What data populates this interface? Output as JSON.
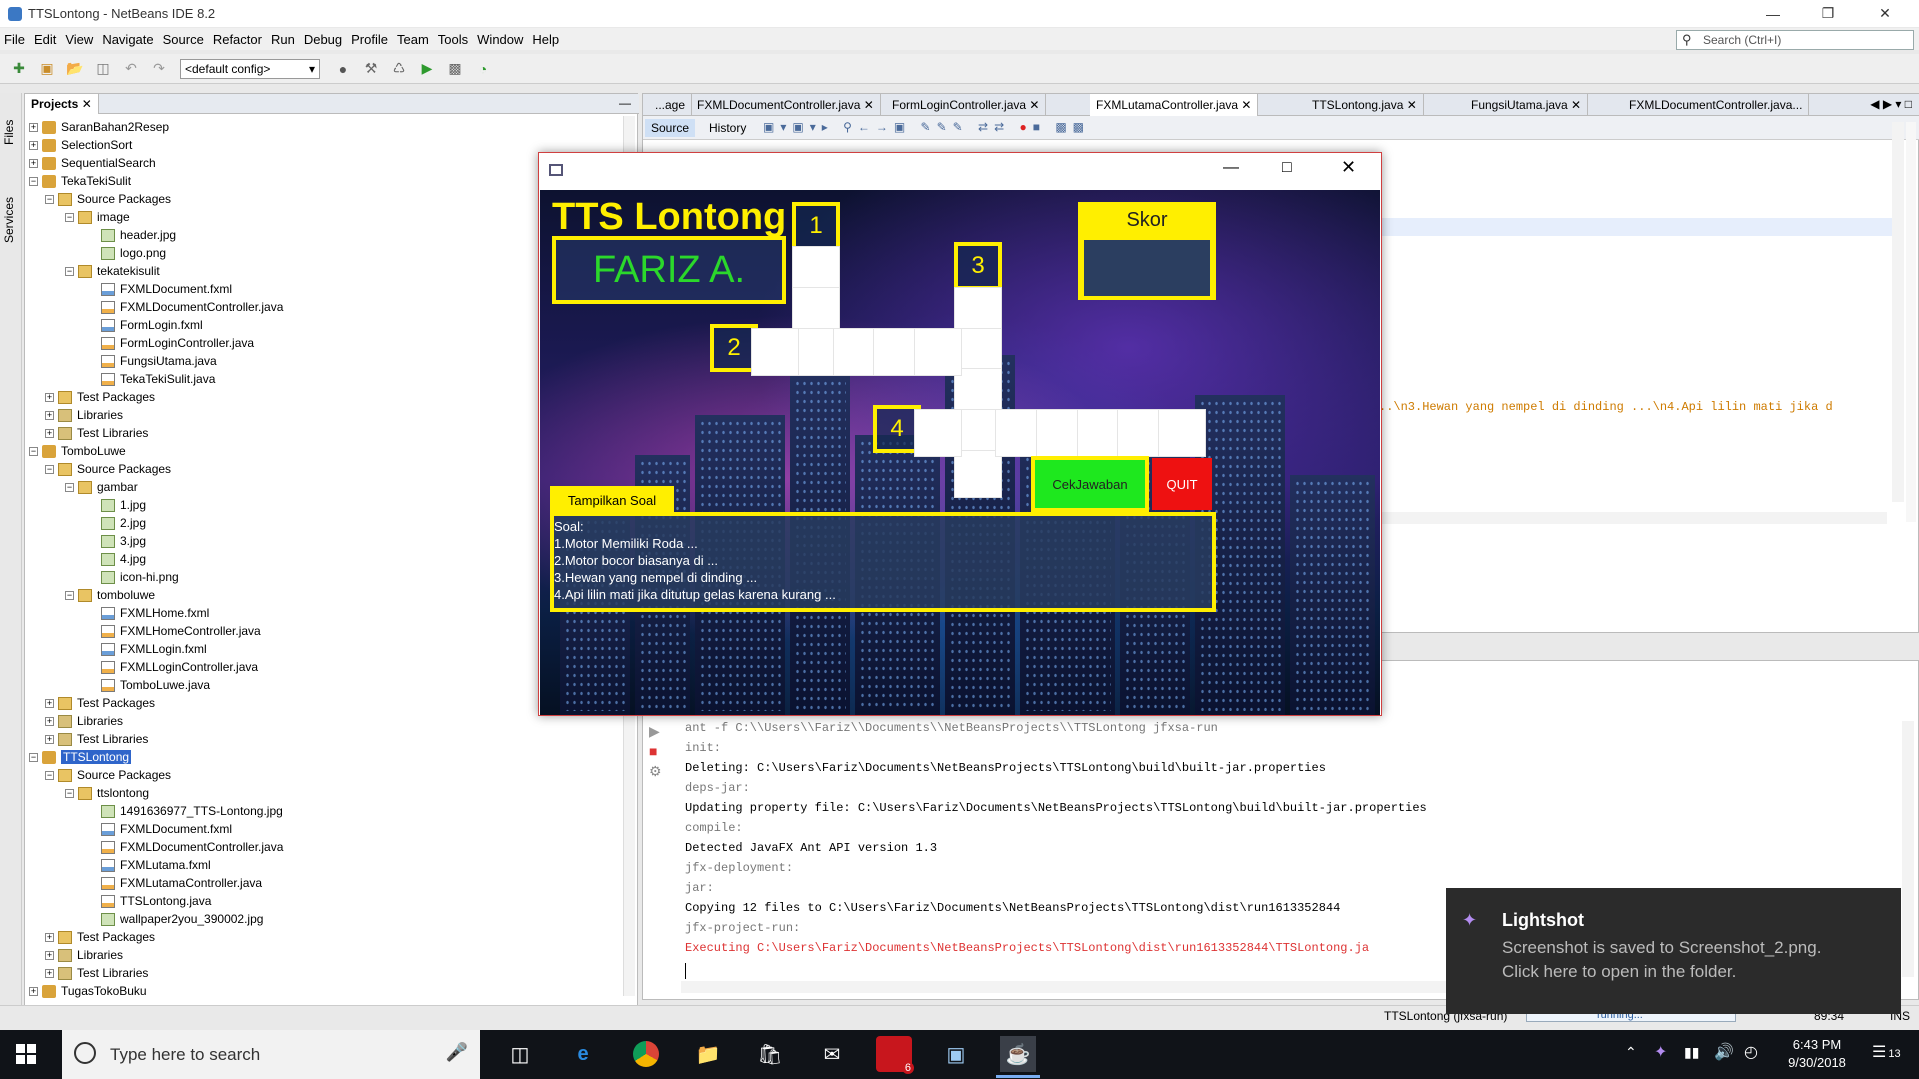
{
  "window": {
    "title": "TTSLontong - NetBeans IDE 8.2"
  },
  "menu": [
    "File",
    "Edit",
    "View",
    "Navigate",
    "Source",
    "Refactor",
    "Run",
    "Debug",
    "Profile",
    "Team",
    "Tools",
    "Window",
    "Help"
  ],
  "search": {
    "placeholder": "Search (Ctrl+I)"
  },
  "toolbar": {
    "config": "<default config>"
  },
  "sidestrip": {
    "files": "Files",
    "services": "Services"
  },
  "projects": {
    "tab": "Projects",
    "nodes": [
      {
        "label": "SaranBahan2Resep"
      },
      {
        "label": "SelectionSort"
      },
      {
        "label": "SequentialSearch"
      },
      {
        "label": "TekaTekiSulit"
      },
      {
        "label": "Source Packages"
      },
      {
        "label": "image"
      },
      {
        "label": "header.jpg"
      },
      {
        "label": "logo.png"
      },
      {
        "label": "tekatekisulit"
      },
      {
        "label": "FXMLDocument.fxml"
      },
      {
        "label": "FXMLDocumentController.java"
      },
      {
        "label": "FormLogin.fxml"
      },
      {
        "label": "FormLoginController.java"
      },
      {
        "label": "FungsiUtama.java"
      },
      {
        "label": "TekaTekiSulit.java"
      },
      {
        "label": "Test Packages"
      },
      {
        "label": "Libraries"
      },
      {
        "label": "Test Libraries"
      },
      {
        "label": "TomboLuwe"
      },
      {
        "label": "Source Packages"
      },
      {
        "label": "gambar"
      },
      {
        "label": "1.jpg"
      },
      {
        "label": "2.jpg"
      },
      {
        "label": "3.jpg"
      },
      {
        "label": "4.jpg"
      },
      {
        "label": "icon-hi.png"
      },
      {
        "label": "tomboluwe"
      },
      {
        "label": "FXMLHome.fxml"
      },
      {
        "label": "FXMLHomeController.java"
      },
      {
        "label": "FXMLLogin.fxml"
      },
      {
        "label": "FXMLLoginController.java"
      },
      {
        "label": "TomboLuwe.java"
      },
      {
        "label": "Test Packages"
      },
      {
        "label": "Libraries"
      },
      {
        "label": "Test Libraries"
      },
      {
        "label": "TTSLontong"
      },
      {
        "label": "Source Packages"
      },
      {
        "label": "ttslontong"
      },
      {
        "label": "1491636977_TTS-Lontong.jpg"
      },
      {
        "label": "FXMLDocument.fxml"
      },
      {
        "label": "FXMLDocumentController.java"
      },
      {
        "label": "FXMLutama.fxml"
      },
      {
        "label": "FXMLutamaController.java"
      },
      {
        "label": "TTSLontong.java"
      },
      {
        "label": "wallpaper2you_390002.jpg"
      },
      {
        "label": "Test Packages"
      },
      {
        "label": "Libraries"
      },
      {
        "label": "Test Libraries"
      },
      {
        "label": "TugasTokoBuku"
      }
    ]
  },
  "editor": {
    "tabs": [
      "...age",
      "FXMLDocumentController.java",
      "FormLoginController.java",
      "FXMLutamaController.java",
      "TTSLontong.java",
      "FungsiUtama.java",
      "FXMLDocumentController.java..."
    ],
    "source": "Source",
    "history": "History",
    "code_semicolon": ");",
    "code_string": "..\\n3.Hewan yang nempel di dinding ...\\n4.Api lilin mati jika d"
  },
  "output": {
    "lines": [
      "ant -f C:\\\\Users\\\\Fariz\\\\Documents\\\\NetBeansProjects\\\\TTSLontong jfxsa-run",
      "init:",
      "Deleting: C:\\Users\\Fariz\\Documents\\NetBeansProjects\\TTSLontong\\build\\built-jar.properties",
      "deps-jar:",
      "Updating property file: C:\\Users\\Fariz\\Documents\\NetBeansProjects\\TTSLontong\\build\\built-jar.properties",
      "compile:",
      "Detected JavaFX Ant API version 1.3",
      "jfx-deployment:",
      "jar:",
      "Copying 12 files to C:\\Users\\Fariz\\Documents\\NetBeansProjects\\TTSLontong\\dist\\run1613352844",
      "jfx-project-run:",
      "Executing C:\\Users\\Fariz\\Documents\\NetBeansProjects\\TTSLontong\\dist\\run1613352844\\TTSLontong.ja"
    ]
  },
  "status": {
    "task": "TTSLontong (jfxsa-run)",
    "progress": "running...",
    "position": "89:34",
    "mode": "INS"
  },
  "app": {
    "title": "TTS Lontong",
    "player": "FARIZ A.",
    "score_label": "Skor",
    "clue_numbers": [
      "1",
      "2",
      "3",
      "4"
    ],
    "show_button": "Tampilkan Soal",
    "check_button": "CekJawaban",
    "quit_button": "QUIT",
    "questions_header": "Soal:",
    "questions": [
      "1.Motor Memiliki Roda ...",
      "2.Motor bocor biasanya di ...",
      "3.Hewan yang nempel di dinding ...",
      "4.Api lilin mati jika ditutup gelas karena kurang ..."
    ]
  },
  "toast": {
    "app": "Lightshot",
    "line1": "Screenshot is saved to Screenshot_2.png.",
    "line2": "Click here to open in the folder."
  },
  "taskbar": {
    "search": "Type here to search",
    "time": "6:43 PM",
    "date": "9/30/2018",
    "badge": "6",
    "notif": "13"
  }
}
